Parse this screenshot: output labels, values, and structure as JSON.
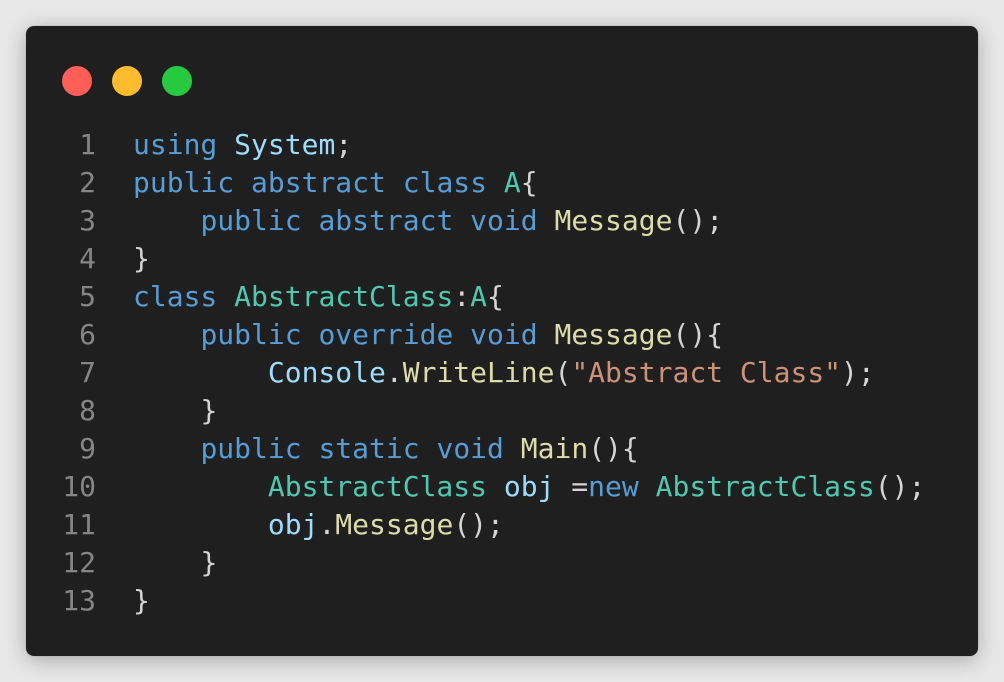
{
  "colors": {
    "background": "#e8e8e8",
    "window": "#1f1f1f",
    "close": "#ff5f56",
    "minimize": "#ffbd2e",
    "maximize": "#27c93f",
    "line_number": "#858585",
    "plain": "#d4d4d4",
    "keyword": "#569cd6",
    "type": "#4ec9b0",
    "function": "#dcdcaa",
    "variable": "#9cdcfe",
    "string": "#ce9178"
  },
  "window_controls": [
    {
      "name": "close-button",
      "icon": "close-dot-icon",
      "color": "#ff5f56"
    },
    {
      "name": "minimize-button",
      "icon": "minimize-dot-icon",
      "color": "#ffbd2e"
    },
    {
      "name": "maximize-button",
      "icon": "maximize-dot-icon",
      "color": "#27c93f"
    }
  ],
  "code": {
    "lines": [
      {
        "number": "1",
        "tokens": [
          {
            "text": "using",
            "kind": "keyword"
          },
          {
            "text": " ",
            "kind": "plain"
          },
          {
            "text": "System",
            "kind": "variable"
          },
          {
            "text": ";",
            "kind": "plain"
          }
        ]
      },
      {
        "number": "2",
        "tokens": [
          {
            "text": "public",
            "kind": "keyword"
          },
          {
            "text": " ",
            "kind": "plain"
          },
          {
            "text": "abstract",
            "kind": "keyword"
          },
          {
            "text": " ",
            "kind": "plain"
          },
          {
            "text": "class",
            "kind": "keyword"
          },
          {
            "text": " ",
            "kind": "plain"
          },
          {
            "text": "A",
            "kind": "type"
          },
          {
            "text": "{",
            "kind": "plain"
          }
        ]
      },
      {
        "number": "3",
        "tokens": [
          {
            "text": "    ",
            "kind": "plain"
          },
          {
            "text": "public",
            "kind": "keyword"
          },
          {
            "text": " ",
            "kind": "plain"
          },
          {
            "text": "abstract",
            "kind": "keyword"
          },
          {
            "text": " ",
            "kind": "plain"
          },
          {
            "text": "void",
            "kind": "keyword"
          },
          {
            "text": " ",
            "kind": "plain"
          },
          {
            "text": "Message",
            "kind": "function"
          },
          {
            "text": "();",
            "kind": "plain"
          }
        ]
      },
      {
        "number": "4",
        "tokens": [
          {
            "text": "}",
            "kind": "plain"
          }
        ]
      },
      {
        "number": "5",
        "tokens": [
          {
            "text": "class",
            "kind": "keyword"
          },
          {
            "text": " ",
            "kind": "plain"
          },
          {
            "text": "AbstractClass",
            "kind": "type"
          },
          {
            "text": ":",
            "kind": "plain"
          },
          {
            "text": "A",
            "kind": "type"
          },
          {
            "text": "{",
            "kind": "plain"
          }
        ]
      },
      {
        "number": "6",
        "tokens": [
          {
            "text": "    ",
            "kind": "plain"
          },
          {
            "text": "public",
            "kind": "keyword"
          },
          {
            "text": " ",
            "kind": "plain"
          },
          {
            "text": "override",
            "kind": "keyword"
          },
          {
            "text": " ",
            "kind": "plain"
          },
          {
            "text": "void",
            "kind": "keyword"
          },
          {
            "text": " ",
            "kind": "plain"
          },
          {
            "text": "Message",
            "kind": "function"
          },
          {
            "text": "(){",
            "kind": "plain"
          }
        ]
      },
      {
        "number": "7",
        "tokens": [
          {
            "text": "        ",
            "kind": "plain"
          },
          {
            "text": "Console",
            "kind": "variable"
          },
          {
            "text": ".",
            "kind": "plain"
          },
          {
            "text": "WriteLine",
            "kind": "function"
          },
          {
            "text": "(",
            "kind": "plain"
          },
          {
            "text": "\"Abstract Class\"",
            "kind": "string"
          },
          {
            "text": ");",
            "kind": "plain"
          }
        ]
      },
      {
        "number": "8",
        "tokens": [
          {
            "text": "    ",
            "kind": "plain"
          },
          {
            "text": "}",
            "kind": "plain"
          }
        ]
      },
      {
        "number": "9",
        "tokens": [
          {
            "text": "    ",
            "kind": "plain"
          },
          {
            "text": "public",
            "kind": "keyword"
          },
          {
            "text": " ",
            "kind": "plain"
          },
          {
            "text": "static",
            "kind": "keyword"
          },
          {
            "text": " ",
            "kind": "plain"
          },
          {
            "text": "void",
            "kind": "keyword"
          },
          {
            "text": " ",
            "kind": "plain"
          },
          {
            "text": "Main",
            "kind": "function"
          },
          {
            "text": "(){",
            "kind": "plain"
          }
        ]
      },
      {
        "number": "10",
        "tokens": [
          {
            "text": "        ",
            "kind": "plain"
          },
          {
            "text": "AbstractClass",
            "kind": "type"
          },
          {
            "text": " ",
            "kind": "plain"
          },
          {
            "text": "obj",
            "kind": "variable"
          },
          {
            "text": " =",
            "kind": "plain"
          },
          {
            "text": "new",
            "kind": "keyword"
          },
          {
            "text": " ",
            "kind": "plain"
          },
          {
            "text": "AbstractClass",
            "kind": "type"
          },
          {
            "text": "();",
            "kind": "plain"
          }
        ]
      },
      {
        "number": "11",
        "tokens": [
          {
            "text": "        ",
            "kind": "plain"
          },
          {
            "text": "obj",
            "kind": "variable"
          },
          {
            "text": ".",
            "kind": "plain"
          },
          {
            "text": "Message",
            "kind": "function"
          },
          {
            "text": "();",
            "kind": "plain"
          }
        ]
      },
      {
        "number": "12",
        "tokens": [
          {
            "text": "    ",
            "kind": "plain"
          },
          {
            "text": "}",
            "kind": "plain"
          }
        ]
      },
      {
        "number": "13",
        "tokens": [
          {
            "text": "}",
            "kind": "plain"
          }
        ]
      }
    ]
  }
}
